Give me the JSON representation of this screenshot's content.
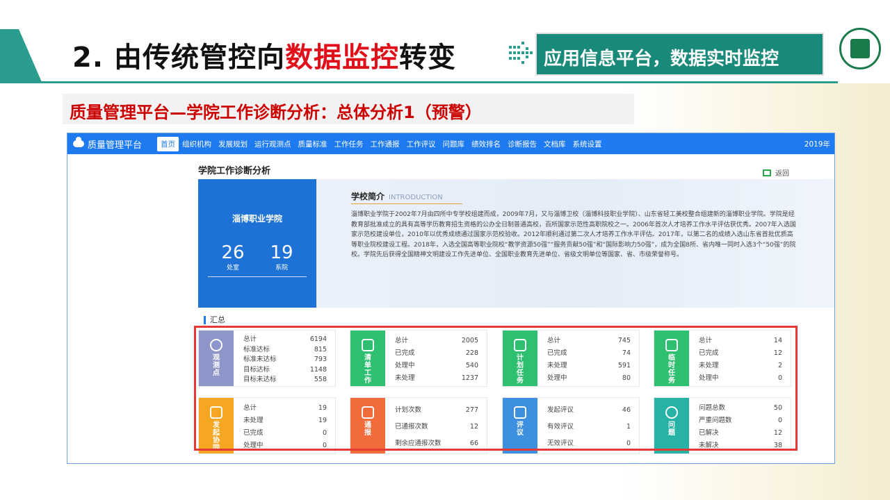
{
  "slide": {
    "title_prefix": "2. 由传统管控向",
    "title_highlight": "数据监控",
    "title_suffix": "转变",
    "banner": "应用信息平台，数据实时监控",
    "subtitle": "质量管理平台—学院工作诊断分析：总体分析1（预警）"
  },
  "navbar": {
    "brand": "质量管理平台",
    "items": [
      "首页",
      "组织机构",
      "发展规划",
      "运行观测点",
      "质量标准",
      "工作任务",
      "工作通报",
      "工作评议",
      "问题库",
      "绩效排名",
      "诊断报告",
      "文档库",
      "系统设置"
    ],
    "year": "2019年"
  },
  "page": {
    "title": "学院工作诊断分析",
    "back": "返回"
  },
  "school": {
    "name": "淄博职业学院",
    "stats": [
      {
        "value": "26",
        "label": "处室"
      },
      {
        "value": "19",
        "label": "系院"
      }
    ],
    "intro_title": "学校简介",
    "intro_en": "INTRODUCTION",
    "intro_text": "淄博职业学院于2002年7月由四所中专学校组建而成，2009年7月，又与淄博卫校（淄博科技职业学院）、山东省轻工美校整合组建新的淄博职业学院。学院是经教育部批准成立的具有高等学历教育招生资格的公办全日制普通高校，百所国家示范性高职院校之一。2006年首次人才培养工作水平评估获优秀。2007年入选国家示范校建设单位，2010年以优秀成绩通过国家示范校验收。2012年顺利通过第二次人才培养工作水平评估。2017年，以第二名的成绩入选山东省首批优质高等职业院校建设工程。2018年，入选全国高等职业院校“教学资源50强”“服务贡献50强”和“国际影响力50强”，成为全国8所、省内唯一同时入选3个“50强”的院校。学院先后获得全国精神文明建设工作先进单位、全国职业教育先进单位、省级文明单位等国家、省、市级荣誉称号。"
  },
  "summary": {
    "title": "汇总",
    "cards": [
      {
        "label": "观测点",
        "icon": "chart-icon",
        "color": "#8e95c9",
        "rows": [
          [
            "总计",
            "6194"
          ],
          [
            "标准达标",
            "815"
          ],
          [
            "标准未达标",
            "793"
          ],
          [
            "目标达标",
            "1148"
          ],
          [
            "目标未达标",
            "558"
          ]
        ]
      },
      {
        "label": "清单工作",
        "icon": "briefcase-icon",
        "color": "#2fbf71",
        "rows": [
          [
            "总计",
            "2005"
          ],
          [
            "已完成",
            "228"
          ],
          [
            "处理中",
            "540"
          ],
          [
            "未处理",
            "1237"
          ]
        ]
      },
      {
        "label": "计划任务",
        "icon": "briefcase-icon",
        "color": "#2fbf71",
        "rows": [
          [
            "总计",
            "745"
          ],
          [
            "已完成",
            "74"
          ],
          [
            "未处理",
            "591"
          ],
          [
            "处理中",
            "80"
          ]
        ]
      },
      {
        "label": "临时任务",
        "icon": "briefcase-icon",
        "color": "#2fbf71",
        "rows": [
          [
            "总计",
            "14"
          ],
          [
            "已完成",
            "12"
          ],
          [
            "未处理",
            "2"
          ],
          [
            "处理中",
            "0"
          ]
        ]
      },
      {
        "label": "发起协同",
        "icon": "briefcase-icon",
        "color": "#f5a623",
        "rows": [
          [
            "总计",
            "19"
          ],
          [
            "未处理",
            "19"
          ],
          [
            "已完成",
            "0"
          ],
          [
            "处理中",
            "0"
          ]
        ]
      },
      {
        "label": "通报",
        "icon": "megaphone-icon",
        "color": "#f26b3a",
        "rows": [
          [
            "计划次数",
            "277"
          ],
          [
            "已通报次数",
            "12"
          ],
          [
            "剩余应通报次数",
            "66"
          ]
        ]
      },
      {
        "label": "评议",
        "icon": "document-icon",
        "color": "#3d8fe0",
        "rows": [
          [
            "发起评议",
            "46"
          ],
          [
            "有效评议",
            "1"
          ],
          [
            "无效评议",
            "0"
          ]
        ]
      },
      {
        "label": "问题",
        "icon": "question-icon",
        "color": "#26b3a6",
        "rows": [
          [
            "问题总数",
            "50"
          ],
          [
            "严重问题数",
            "0"
          ],
          [
            "已解决",
            "12"
          ],
          [
            "未解决",
            "38"
          ]
        ]
      }
    ]
  }
}
